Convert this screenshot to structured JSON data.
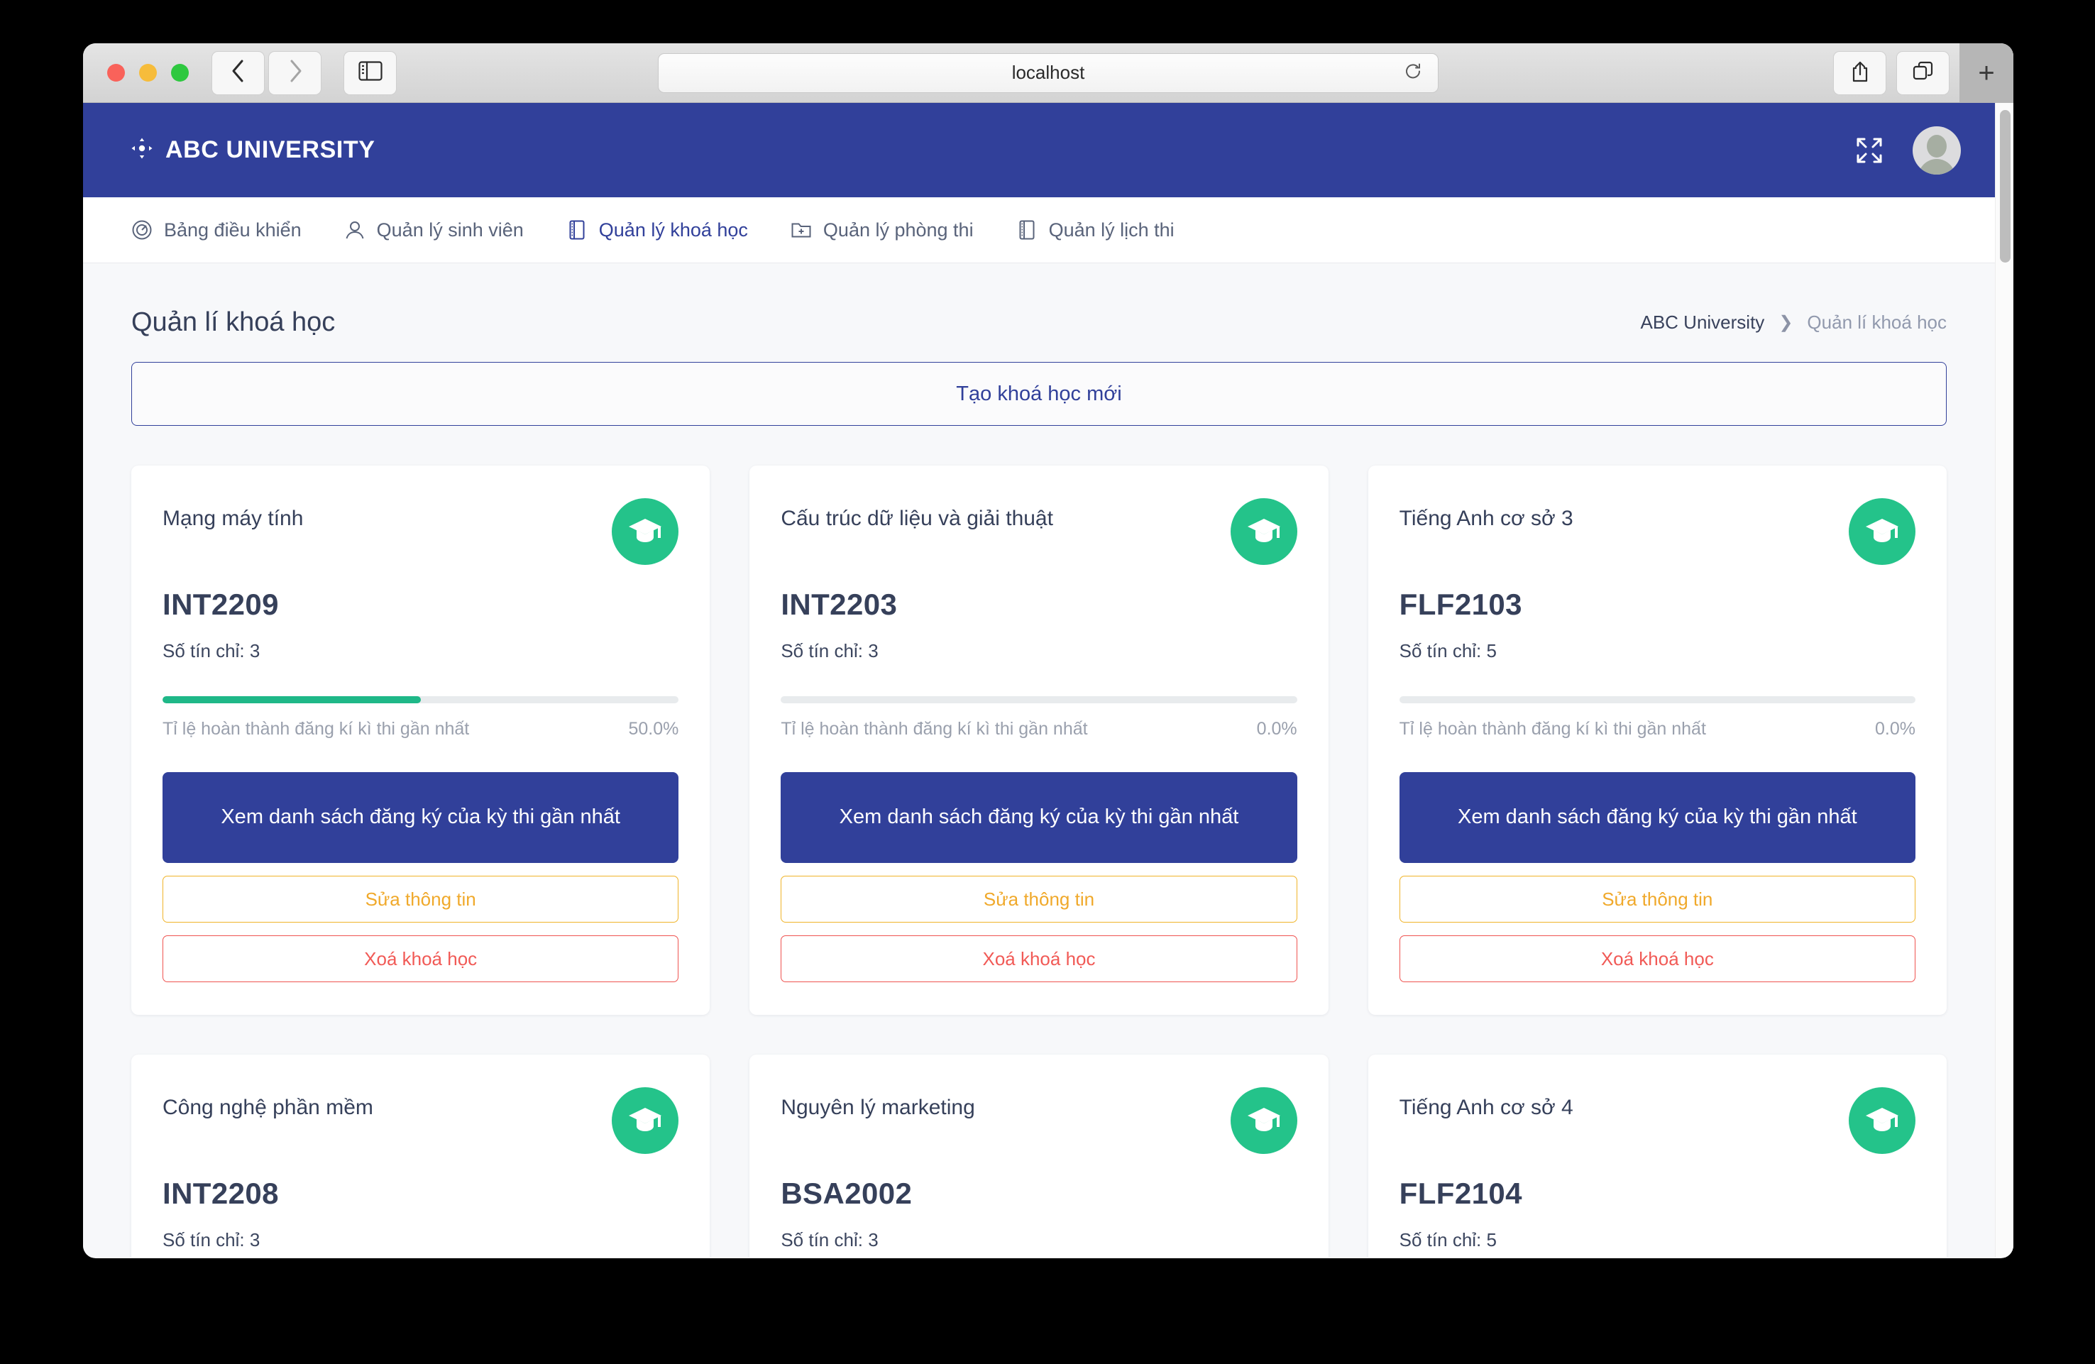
{
  "browser": {
    "url": "localhost",
    "back_icon": "chevron-left-icon",
    "forward_icon": "chevron-right-icon",
    "sidebar_icon": "sidebar-icon",
    "reload_icon": "reload-icon",
    "share_icon": "share-icon",
    "tabs_icon": "tab-overview-icon",
    "newtab_label": "+"
  },
  "header": {
    "brand": "ABC UNIVERSITY",
    "logo_icon": "move-arrows-icon",
    "expand_icon": "fullscreen-expand-icon",
    "avatar_icon": "user-avatar-icon"
  },
  "nav": {
    "items": [
      {
        "label": "Bảng điều khiển",
        "icon": "gauge-icon",
        "active": false
      },
      {
        "label": "Quản lý sinh viên",
        "icon": "user-icon",
        "active": false
      },
      {
        "label": "Quản lý khoá học",
        "icon": "book-icon",
        "active": true
      },
      {
        "label": "Quản lý phòng thi",
        "icon": "folder-plus-icon",
        "active": false
      },
      {
        "label": "Quản lý lịch thi",
        "icon": "book-icon",
        "active": false
      }
    ]
  },
  "page": {
    "title": "Quản lí khoá học",
    "breadcrumb": {
      "root": "ABC University",
      "separator": "❯",
      "current": "Quản lí khoá học"
    },
    "create_button": "Tạo khoá học mới"
  },
  "card_labels": {
    "credits_prefix": "Số tín chỉ:",
    "progress_label": "Tỉ lệ hoàn thành đăng kí kì thi gần nhất",
    "view_registrations": "Xem danh sách đăng ký của kỳ thi gần nhất",
    "edit": "Sửa thông tin",
    "delete": "Xoá khoá học",
    "badge_icon": "graduation-cap-icon"
  },
  "colors": {
    "brand_blue": "#31409a",
    "badge_green": "#24c38a",
    "progress_green": "#1fb888",
    "edit_yellow": "#f0b429",
    "delete_red": "#ef5350"
  },
  "courses": [
    {
      "name": "Mạng máy tính",
      "code": "INT2209",
      "credits": "3",
      "progress_text": "50.0%",
      "progress_value": 50
    },
    {
      "name": "Cấu trúc dữ liệu và giải thuật",
      "code": "INT2203",
      "credits": "3",
      "progress_text": "0.0%",
      "progress_value": 0
    },
    {
      "name": "Tiếng Anh cơ sở 3",
      "code": "FLF2103",
      "credits": "5",
      "progress_text": "0.0%",
      "progress_value": 0
    },
    {
      "name": "Công nghệ phần mềm",
      "code": "INT2208",
      "credits": "3",
      "progress_text": "",
      "progress_value": 0
    },
    {
      "name": "Nguyên lý marketing",
      "code": "BSA2002",
      "credits": "3",
      "progress_text": "",
      "progress_value": 0
    },
    {
      "name": "Tiếng Anh cơ sở 4",
      "code": "FLF2104",
      "credits": "5",
      "progress_text": "",
      "progress_value": 0
    }
  ]
}
